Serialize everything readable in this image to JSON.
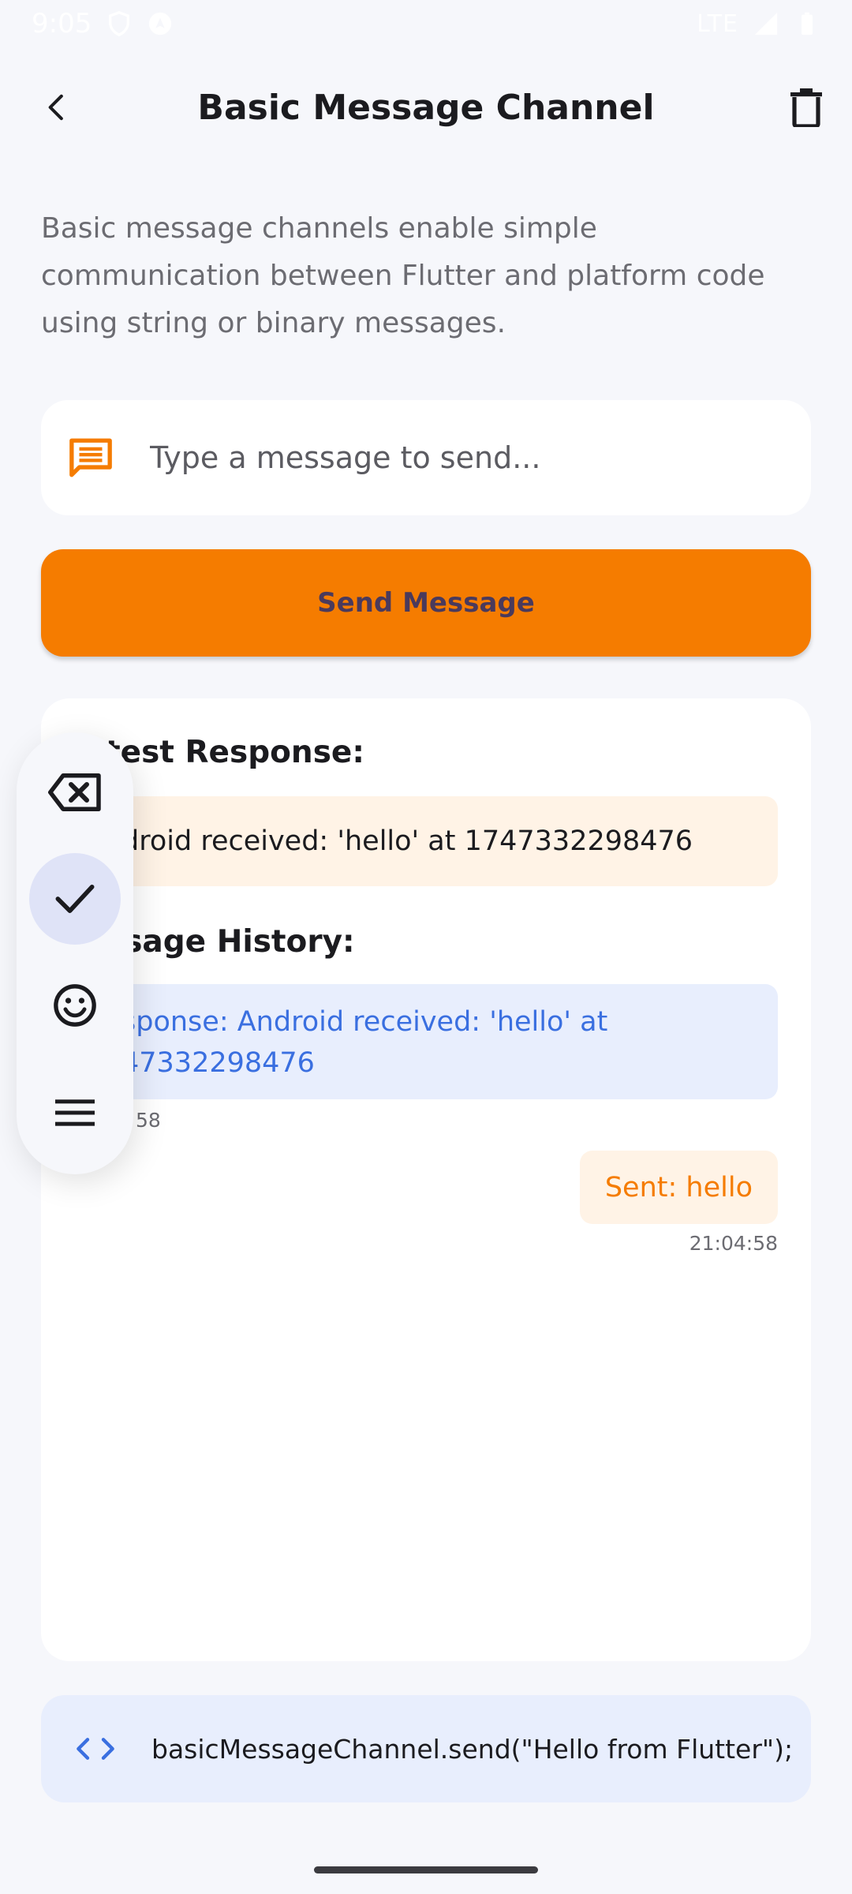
{
  "status_bar": {
    "time": "9:05",
    "network": "LTE"
  },
  "app_bar": {
    "title": "Basic Message Channel"
  },
  "description": "Basic message channels enable simple communication between Flutter and platform code using string or binary messages.",
  "message_input": {
    "placeholder": "Type a message to send...",
    "value": ""
  },
  "send_button": {
    "label": "Send Message"
  },
  "latest_response": {
    "title": "test Response:",
    "value": "droid received: 'hello' at 1747332298476"
  },
  "message_history": {
    "title": "ssage History:",
    "received": {
      "text": "sponse: Android received: 'hello' at 47332298476",
      "time": "58"
    },
    "sent": {
      "text": "Sent: hello",
      "time": "21:04:58"
    }
  },
  "code_snippet": {
    "text": "basicMessageChannel.send(\"Hello from Flutter\");"
  },
  "colors": {
    "accent": "#f57c00",
    "accent_light": "#fff3e6",
    "blue": "#3a6fe0",
    "blue_light": "#e8eefd",
    "background": "#f6f7fb"
  },
  "icons": {
    "back": "arrow-left-icon",
    "delete": "trash-icon",
    "message": "message-icon",
    "code": "code-icon",
    "toolbar": [
      "backspace-icon",
      "check-icon",
      "emoji-icon",
      "menu-icon"
    ]
  }
}
